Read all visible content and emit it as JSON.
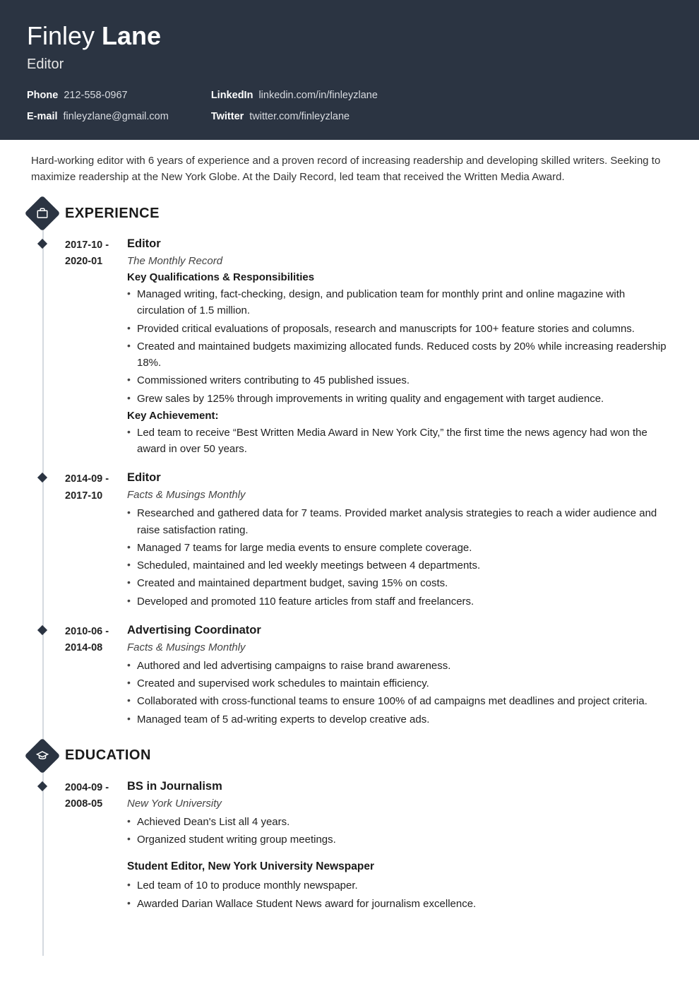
{
  "name_first": "Finley",
  "name_last": "Lane",
  "title": "Editor",
  "contacts": {
    "phone_label": "Phone",
    "phone_value": "212-558-0967",
    "email_label": "E-mail",
    "email_value": "finleyzlane@gmail.com",
    "linkedin_label": "LinkedIn",
    "linkedin_value": "linkedin.com/in/finleyzlane",
    "twitter_label": "Twitter",
    "twitter_value": "twitter.com/finleyzlane"
  },
  "summary": "Hard-working editor with 6 years of experience and a proven record of increasing readership and developing skilled writers. Seeking to maximize readership at the New York Globe. At the Daily Record, led team that received the Written Media Award.",
  "sections": {
    "experience_title": "EXPERIENCE",
    "education_title": "EDUCATION"
  },
  "experience": [
    {
      "date_start": "2017-10 -",
      "date_end": "2020-01",
      "title": "Editor",
      "company": "The Monthly Record",
      "qual_header": "Key Qualifications & Responsibilities",
      "bullets": [
        "Managed writing, fact-checking, design, and publication team for monthly print and online magazine with circulation of 1.5 million.",
        "Provided critical evaluations of proposals, research and manuscripts for 100+ feature stories and columns.",
        "Created and maintained budgets maximizing allocated funds. Reduced costs by 20% while increasing readership 18%.",
        "Commissioned writers contributing to 45 published issues.",
        "Grew sales by 125% through improvements in writing quality and engagement with target audience."
      ],
      "ach_header": "Key Achievement:",
      "achievements": [
        "Led team to receive “Best Written Media Award in New York City,” the first time the news agency had won the award in over 50 years."
      ]
    },
    {
      "date_start": "2014-09 -",
      "date_end": "2017-10",
      "title": "Editor",
      "company": "Facts & Musings Monthly",
      "bullets": [
        "Researched and gathered data for 7 teams. Provided market analysis strategies to reach a wider audience and raise satisfaction rating.",
        "Managed 7 teams for large media events to ensure complete coverage.",
        "Scheduled, maintained and led weekly meetings between 4 departments.",
        "Created and maintained department budget, saving 15% on costs.",
        "Developed and promoted 110 feature articles from staff and freelancers."
      ]
    },
    {
      "date_start": "2010-06 -",
      "date_end": "2014-08",
      "title": "Advertising Coordinator",
      "company": "Facts & Musings Monthly",
      "bullets": [
        "Authored and led advertising campaigns to raise brand awareness.",
        "Created and supervised work schedules to maintain efficiency.",
        "Collaborated with cross-functional teams to ensure 100% of ad campaigns met deadlines and project criteria.",
        "Managed team of 5 ad-writing experts to develop creative ads."
      ]
    }
  ],
  "education": [
    {
      "date_start": "2004-09 -",
      "date_end": "2008-05",
      "title": "BS in Journalism",
      "company": "New York University",
      "bullets": [
        "Achieved Dean's List all 4 years.",
        "Organized student writing group meetings."
      ],
      "sub_title": "Student Editor, New York University Newspaper",
      "sub_bullets": [
        "Led team of 10 to produce monthly newspaper.",
        "Awarded Darian Wallace Student News award for journalism excellence."
      ]
    }
  ]
}
